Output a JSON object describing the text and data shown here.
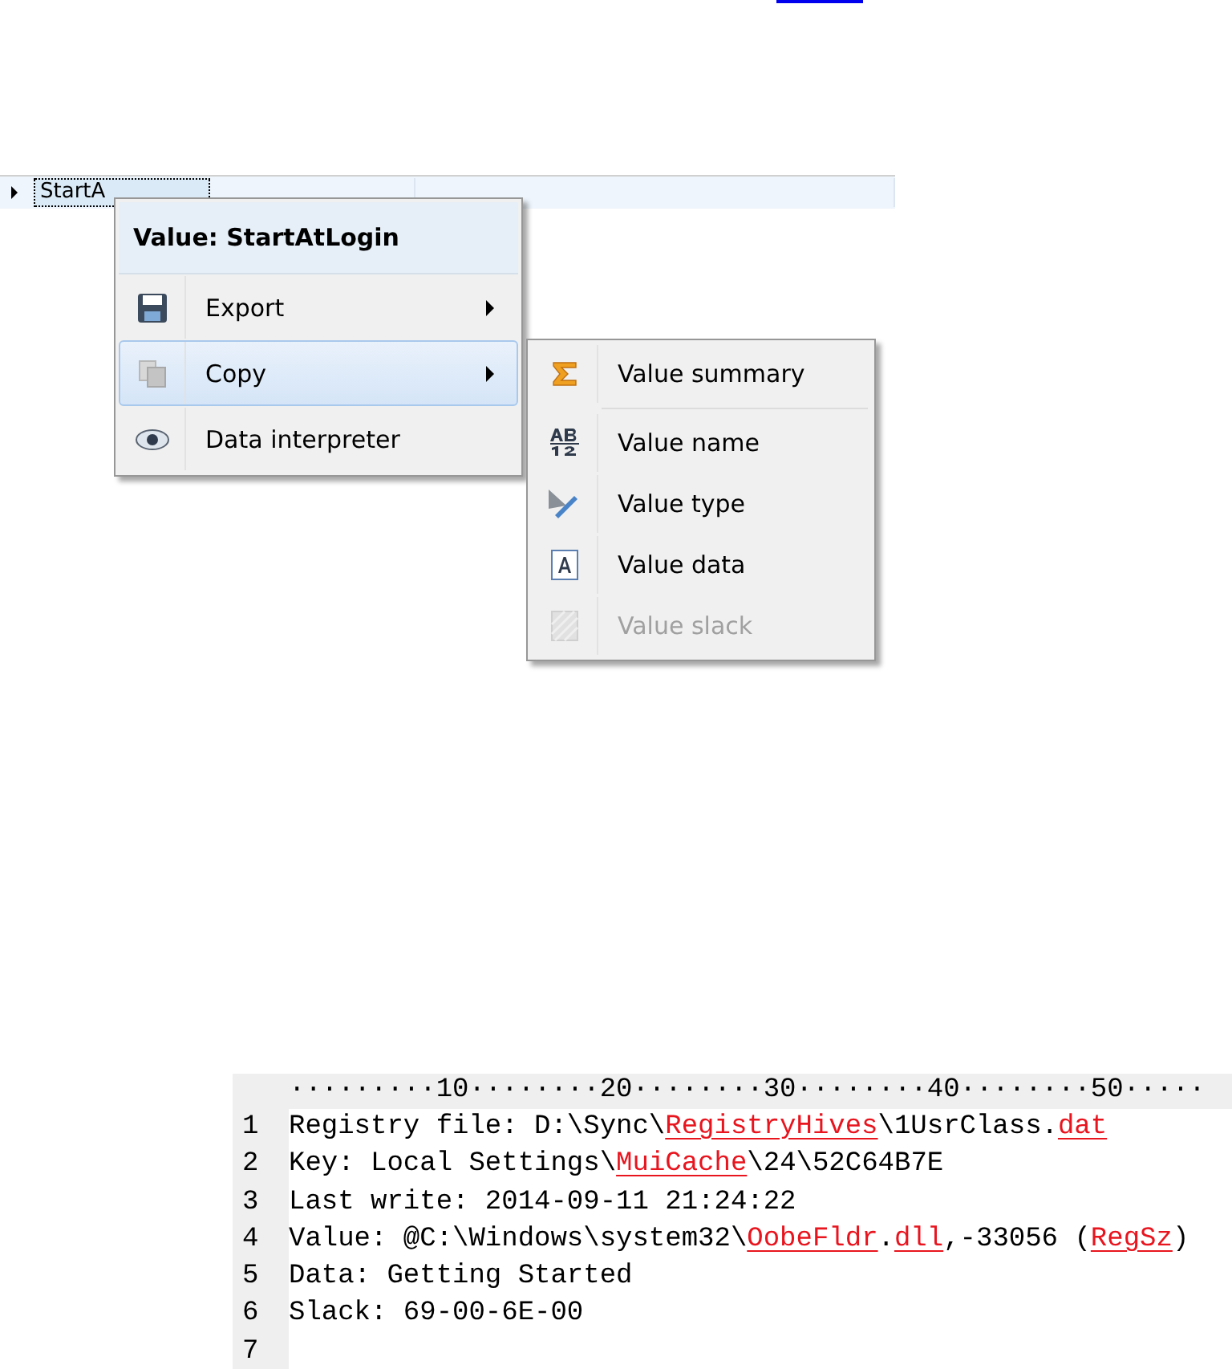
{
  "grid_row": {
    "cells": [
      "StartA",
      "",
      ""
    ],
    "selected": true
  },
  "context_menu": {
    "title": "Value: StartAtLogin",
    "items": [
      {
        "label": "Export",
        "selected": false,
        "submenu": true
      },
      {
        "label": "Copy",
        "selected": true,
        "submenu": true
      },
      {
        "label": "Data interpreter",
        "selected": false,
        "submenu": false
      }
    ]
  },
  "submenu": {
    "items": [
      {
        "label": "Value summary",
        "disabled": false
      },
      {
        "label": "Value name",
        "disabled": false
      },
      {
        "label": "Value type",
        "disabled": false
      },
      {
        "label": "Value data",
        "disabled": false
      },
      {
        "label": "Value slack",
        "disabled": true
      }
    ]
  },
  "editor": {
    "ruler": "·········10········20········30········40········50·····",
    "lines": [
      {
        "number": "1",
        "segments": [
          {
            "text": "Registry file: D:\\Sync\\",
            "misspelled": false
          },
          {
            "text": "RegistryHives",
            "misspelled": true
          },
          {
            "text": "\\1UsrClass.",
            "misspelled": false
          },
          {
            "text": "dat",
            "misspelled": true
          }
        ]
      },
      {
        "number": "2",
        "segments": [
          {
            "text": "Key: Local Settings\\",
            "misspelled": false
          },
          {
            "text": "MuiCache",
            "misspelled": true
          },
          {
            "text": "\\24\\52C64B7E",
            "misspelled": false
          }
        ]
      },
      {
        "number": "3",
        "segments": [
          {
            "text": "Last write: 2014-09-11 21:24:22",
            "misspelled": false
          }
        ]
      },
      {
        "number": "4",
        "segments": [
          {
            "text": "Value: @C:\\Windows\\system32\\",
            "misspelled": false
          },
          {
            "text": "OobeFldr",
            "misspelled": true
          },
          {
            "text": ".",
            "misspelled": false
          },
          {
            "text": "dll",
            "misspelled": true
          },
          {
            "text": ",-33056 (",
            "misspelled": false
          },
          {
            "text": "RegSz",
            "misspelled": true
          },
          {
            "text": ")",
            "misspelled": false
          }
        ]
      },
      {
        "number": "5",
        "segments": [
          {
            "text": "Data: Getting Started",
            "misspelled": false
          }
        ]
      },
      {
        "number": "6",
        "segments": [
          {
            "text": "Slack: 69-00-6E-00",
            "misspelled": false
          }
        ]
      },
      {
        "number": "7"
      }
    ]
  }
}
